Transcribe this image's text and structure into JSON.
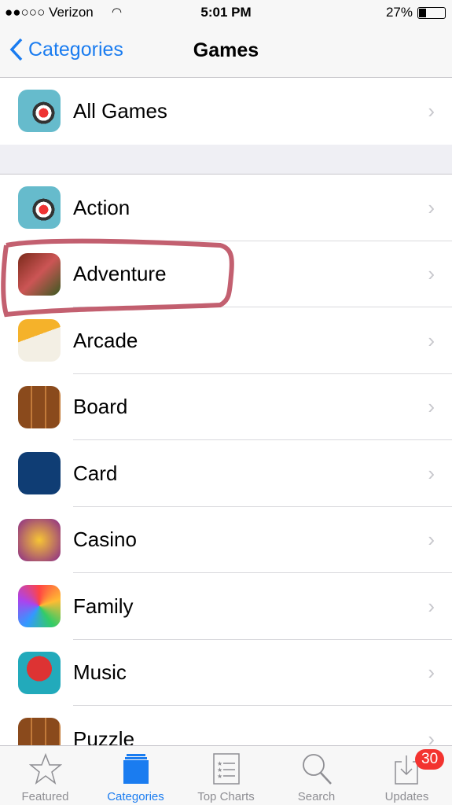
{
  "status": {
    "carrier": "●●○○○ Verizon",
    "time": "5:01 PM",
    "battery": "27%"
  },
  "nav": {
    "back_label": "Categories",
    "title": "Games"
  },
  "top_item": {
    "label": "All Games",
    "icon": "archery-icon"
  },
  "items": [
    {
      "label": "Action",
      "icon": "archery-icon"
    },
    {
      "label": "Adventure",
      "icon": "roblox-icon",
      "highlighted": true
    },
    {
      "label": "Arcade",
      "icon": "bird-icon"
    },
    {
      "label": "Board",
      "icon": "wood-puzzle-icon"
    },
    {
      "label": "Card",
      "icon": "cards-icon"
    },
    {
      "label": "Casino",
      "icon": "casino-icon"
    },
    {
      "label": "Family",
      "icon": "trivia-icon"
    },
    {
      "label": "Music",
      "icon": "ball-icon"
    },
    {
      "label": "Puzzle",
      "icon": "wood-puzzle-icon"
    }
  ],
  "tabs": [
    {
      "label": "Featured"
    },
    {
      "label": "Categories",
      "active": true
    },
    {
      "label": "Top Charts"
    },
    {
      "label": "Search"
    },
    {
      "label": "Updates",
      "badge": "30"
    }
  ],
  "colors": {
    "accent": "#1a7cf0",
    "badge": "#f3332f",
    "annotation": "#b84457"
  }
}
